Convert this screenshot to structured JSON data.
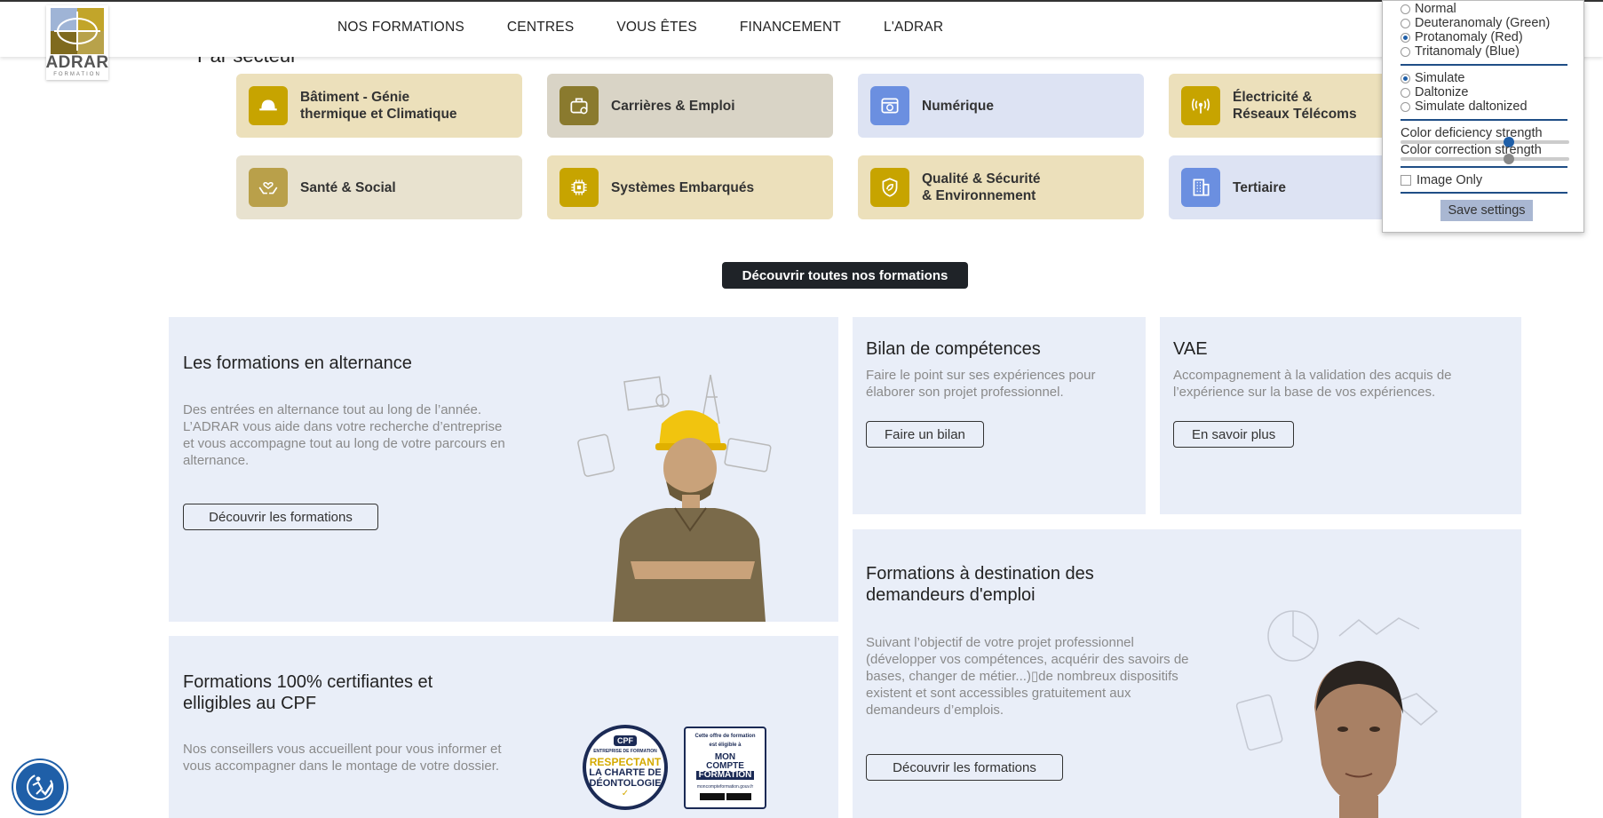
{
  "header": {
    "logo_name": "ADRAR",
    "logo_sub": "FORMATION",
    "nav": [
      "NOS FORMATIONS",
      "CENTRES",
      "VOUS ÊTES",
      "FINANCEMENT",
      "L'ADRAR"
    ]
  },
  "sectors": {
    "heading": "Par secteur",
    "tiles": [
      {
        "label": "Bâtiment - Génie\nthermique et Climatique",
        "icon": "helmet-icon",
        "bg": "#ece0bb",
        "icon_bg": "#c7a400"
      },
      {
        "label": "Carrières & Emploi",
        "icon": "briefcase-icon",
        "bg": "#d9d4c6",
        "icon_bg": "#8a7a2e"
      },
      {
        "label": "Numérique",
        "icon": "browser-icon",
        "bg": "#dde3f3",
        "icon_bg": "#6b8fe0"
      },
      {
        "label": "Électricité &\nRéseaux Télécoms",
        "icon": "antenna-icon",
        "bg": "#ece0bb",
        "icon_bg": "#c7a400"
      },
      {
        "label": "Santé & Social",
        "icon": "care-hands-icon",
        "bg": "#e8e2cf",
        "icon_bg": "#b9a04a"
      },
      {
        "label": "Systèmes Embarqués",
        "icon": "chip-icon",
        "bg": "#ece0bb",
        "icon_bg": "#c7a400"
      },
      {
        "label": "Qualité & Sécurité\n& Environnement",
        "icon": "shield-leaf-icon",
        "bg": "#ece0bb",
        "icon_bg": "#c7a400"
      },
      {
        "label": "Tertiaire",
        "icon": "building-icon",
        "bg": "#dde3f3",
        "icon_bg": "#6b8fe0"
      }
    ],
    "cta": "Découvrir toutes nos formations"
  },
  "cards": {
    "alternance": {
      "title": "Les formations en alternance",
      "text": "Des entrées en alternance tout au long de l’année. L’ADRAR vous aide dans votre recherche d’entreprise et vous accompagne tout au long de votre parcours en alternance.",
      "button": "Découvrir les formations"
    },
    "bilan": {
      "title": "Bilan de compétences",
      "text": "Faire le point sur ses expériences pour élaborer son projet professionnel.",
      "button": "Faire un bilan"
    },
    "vae": {
      "title": "VAE",
      "text": "Accompagnement à la validation des acquis de l’expérience sur la base de vos expériences.",
      "button": "En savoir plus"
    },
    "cpf": {
      "title": "Formations 100% certifiantes et elligibles au CPF",
      "text": "Nos conseillers vous accueillent pour vous informer et vous accompagner dans le montage de votre dossier.",
      "badge1": [
        "CPF",
        "ENTREPRISE DE FORMATION",
        "RESPECTANT",
        "LA CHARTE DE",
        "DÉONTOLOGIE"
      ],
      "badge2": [
        "Cette offre de formation",
        "est éligible à",
        "MON",
        "COMPTE",
        "FORMATION",
        "moncompteformation.gouv.fr"
      ]
    },
    "demandeurs": {
      "title": "Formations à destination des demandeurs d'emploi",
      "text": "Suivant l’objectif de votre projet professionnel (développer vos compétences, acquérir des savoirs de bases, changer de métier...)▯de nombreux dispositifs existent et sont accessibles gratuitement aux demandeurs d’emplois.",
      "button": "Découvrir les formations"
    }
  },
  "color_panel": {
    "modes": [
      {
        "label": "Normal",
        "selected": false
      },
      {
        "label": "Deuteranomaly (Green)",
        "selected": false
      },
      {
        "label": "Protanomaly (Red)",
        "selected": true
      },
      {
        "label": "Tritanomaly (Blue)",
        "selected": false
      }
    ],
    "methods": [
      {
        "label": "Simulate",
        "selected": true
      },
      {
        "label": "Daltonize",
        "selected": false
      },
      {
        "label": "Simulate daltonized",
        "selected": false
      }
    ],
    "deficiency_label": "Color deficiency strength",
    "correction_label": "Color correction strength",
    "image_only_label": "Image Only",
    "save_label": "Save settings"
  },
  "colors": {
    "card_bg": "#e9eef8",
    "accent_blue": "#1f5fa8",
    "dark_button": "#1f2328"
  }
}
